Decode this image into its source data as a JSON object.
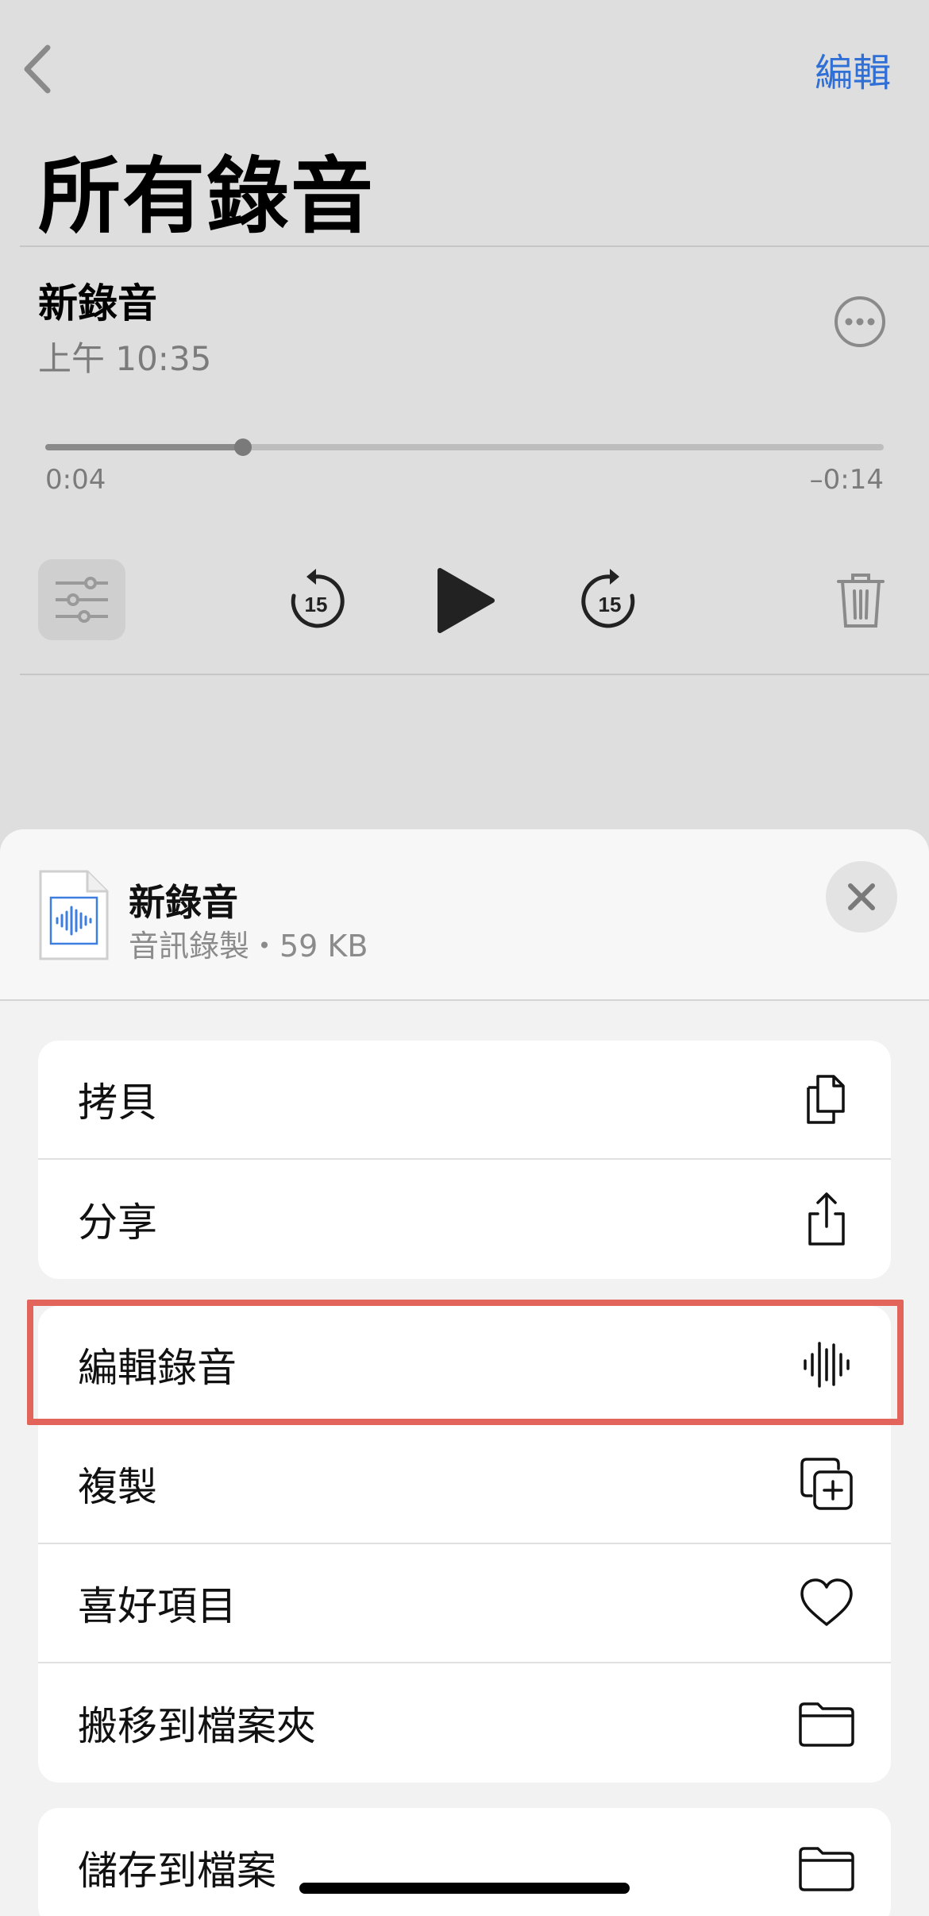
{
  "nav": {
    "edit_label": "編輯",
    "title": "所有錄音"
  },
  "recording": {
    "name": "新錄音",
    "time": "上午 10:35",
    "elapsed": "0:04",
    "remaining": "–0:14",
    "progress_fraction": 0.236
  },
  "sheet": {
    "file_name": "新錄音",
    "file_meta": "音訊錄製・59 KB",
    "group1": [
      {
        "label": "拷貝",
        "icon": "copy-icon"
      },
      {
        "label": "分享",
        "icon": "share-icon"
      }
    ],
    "group2": [
      {
        "label": "編輯錄音",
        "icon": "waveform-icon"
      },
      {
        "label": "複製",
        "icon": "duplicate-icon"
      },
      {
        "label": "喜好項目",
        "icon": "heart-icon"
      },
      {
        "label": "搬移到檔案夾",
        "icon": "folder-icon"
      }
    ],
    "group3": [
      {
        "label": "儲存到檔案",
        "icon": "folder-icon"
      }
    ]
  },
  "colors": {
    "accent": "#2f6fd6",
    "highlight": "#e2645a"
  }
}
